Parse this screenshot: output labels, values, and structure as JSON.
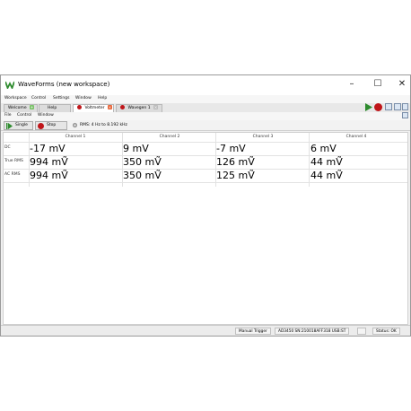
{
  "window": {
    "title": "WaveForms (new workspace)"
  },
  "menubar": [
    "Workspace",
    "Control",
    "Settings",
    "Window",
    "Help"
  ],
  "tabs": [
    {
      "label": "Welcome"
    },
    {
      "label": "Help"
    },
    {
      "label": "Voltmeter"
    },
    {
      "label": "Wavegen 1"
    }
  ],
  "submenu": [
    "File",
    "Control",
    "Window"
  ],
  "toolbar": {
    "single_label": "Single",
    "stop_label": "Stop",
    "range_text": "RMS: 4 Hz to 8.192 kHz"
  },
  "table": {
    "columns": [
      "Channel 1",
      "Channel 2",
      "Channel 3",
      "Channel 4"
    ],
    "rows": [
      {
        "label": "DC",
        "values": [
          "-17 mV",
          "9 mV",
          "-7 mV",
          "6 mV"
        ]
      },
      {
        "label": "True RMS",
        "values": [
          "994 mṼ",
          "350 mṼ",
          "126 mṼ",
          "44 mṼ"
        ]
      },
      {
        "label": "AC RMS",
        "values": [
          "994 mṼ",
          "350 mṼ",
          "125 mṼ",
          "44 mṼ"
        ]
      }
    ]
  },
  "status": {
    "trigger": "Manual Trigger",
    "device": "AD3450 SN:210018AFF318 USB:ST",
    "status": "Status: OK"
  },
  "colors": {
    "accent_green": "#2e8b2e",
    "stop_red": "#c0161a"
  }
}
